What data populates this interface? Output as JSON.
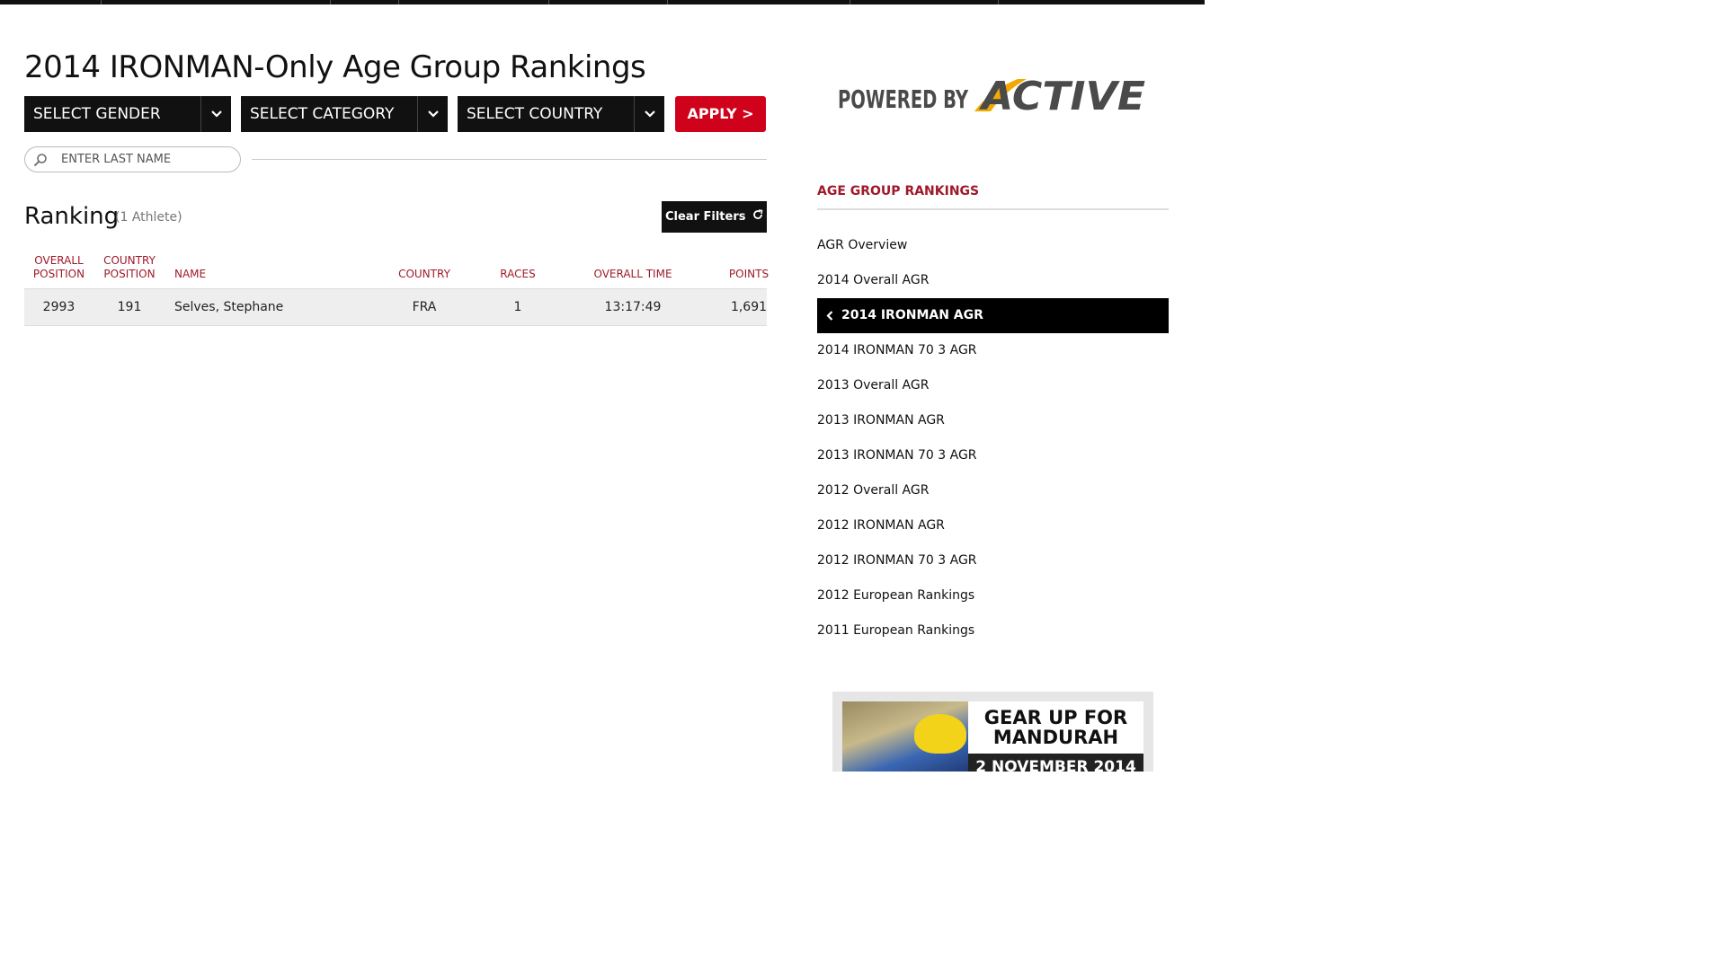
{
  "page": {
    "title": "2014 IRONMAN-Only Age Group Rankings"
  },
  "filters": {
    "gender": "SELECT GENDER",
    "category": "SELECT CATEGORY",
    "country": "SELECT COUNTRY",
    "apply_label": "APPLY >"
  },
  "search": {
    "placeholder": "ENTER LAST NAME"
  },
  "ranking": {
    "title": "Ranking",
    "count": "(1 Athlete)",
    "clear_filters_label": "Clear Filters"
  },
  "table": {
    "headers": {
      "overall_position": "OVERALL POSITION",
      "country_position": "COUNTRY POSITION",
      "name": "NAME",
      "country": "COUNTRY",
      "races": "RACES",
      "overall_time": "OVERALL TIME",
      "points": "POINTS"
    },
    "rows": [
      {
        "overall_position": "2993",
        "country_position": "191",
        "name": "Selves, Stephane",
        "country": "FRA",
        "races": "1",
        "overall_time": "13:17:49",
        "points": "1,691"
      }
    ]
  },
  "sidebar": {
    "logo_powered": "POWERED BY",
    "logo_brand": "ACTIVE",
    "heading": "AGE GROUP RANKINGS",
    "items": [
      {
        "label": "AGR Overview",
        "active": false
      },
      {
        "label": "2014 Overall AGR",
        "active": false
      },
      {
        "label": "2014 IRONMAN AGR",
        "active": true
      },
      {
        "label": "2014 IRONMAN 70 3 AGR",
        "active": false
      },
      {
        "label": "2013 Overall AGR",
        "active": false
      },
      {
        "label": "2013 IRONMAN AGR",
        "active": false
      },
      {
        "label": "2013 IRONMAN 70 3 AGR",
        "active": false
      },
      {
        "label": "2012 Overall AGR",
        "active": false
      },
      {
        "label": "2012 IRONMAN AGR",
        "active": false
      },
      {
        "label": "2012 IRONMAN 70 3 AGR",
        "active": false
      },
      {
        "label": "2012 European Rankings",
        "active": false
      },
      {
        "label": "2011 European Rankings",
        "active": false
      }
    ]
  },
  "ad": {
    "headline_line1": "GEAR UP FOR",
    "headline_line2": "MANDURAH",
    "date_text": "2 NOVEMBER 2014"
  },
  "colors": {
    "accent_red": "#d0021b",
    "header_red": "#a0192a",
    "dark": "#111111"
  }
}
